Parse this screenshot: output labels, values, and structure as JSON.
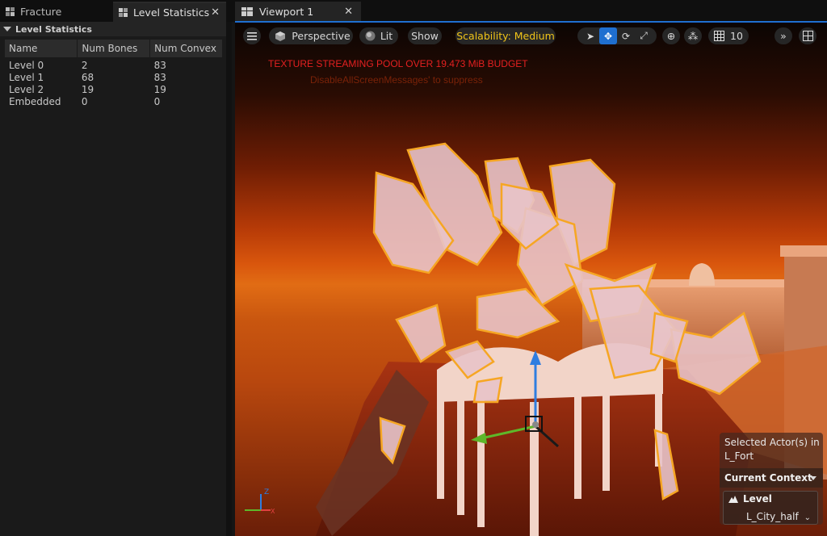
{
  "left_tabs": {
    "fracture": "Fracture",
    "level_statistics": "Level Statistics"
  },
  "level_stats": {
    "section_title": "Level Statistics",
    "columns": [
      "Name",
      "Num Bones",
      "Num Convex"
    ],
    "rows": [
      [
        "Level 0",
        "2",
        "83"
      ],
      [
        "Level 1",
        "68",
        "83"
      ],
      [
        "Level 2",
        "19",
        "19"
      ],
      [
        "Embedded",
        "0",
        "0"
      ]
    ]
  },
  "viewport_tab": {
    "title": "Viewport 1"
  },
  "toolbar": {
    "perspective": "Perspective",
    "lit": "Lit",
    "show": "Show",
    "scalability": "Scalability: Medium",
    "grid_size": "10"
  },
  "messages": {
    "warning": "TEXTURE STREAMING POOL OVER 19.473 MiB BUDGET",
    "suppress": "DisableAllScreenMessages' to suppress"
  },
  "context_widget": {
    "selected_line1": "Selected Actor(s) in",
    "selected_line2": "L_Fort",
    "current_context": "Current Context",
    "level_label": "Level",
    "level_value": "L_City_half"
  },
  "colors": {
    "accent": "#1f6fd0",
    "scalability": "#f0c419",
    "warning": "#e42020",
    "selection_outline": "#f6a623"
  },
  "icons": {
    "fracture_tab": "fracture-icon",
    "stats_tab": "stats-icon",
    "viewport_tab": "viewport-icon",
    "menu": "hamburger-icon",
    "perspective": "cube-icon",
    "lit": "sphere-icon",
    "select": "cursor-icon",
    "translate": "move-icon",
    "rotate": "rotate-icon",
    "scale": "scale-icon",
    "world": "globe-icon",
    "snap": "surface-snap-icon",
    "grid": "grid-icon",
    "more": "double-chevron-icon",
    "layout": "layout-icon"
  }
}
